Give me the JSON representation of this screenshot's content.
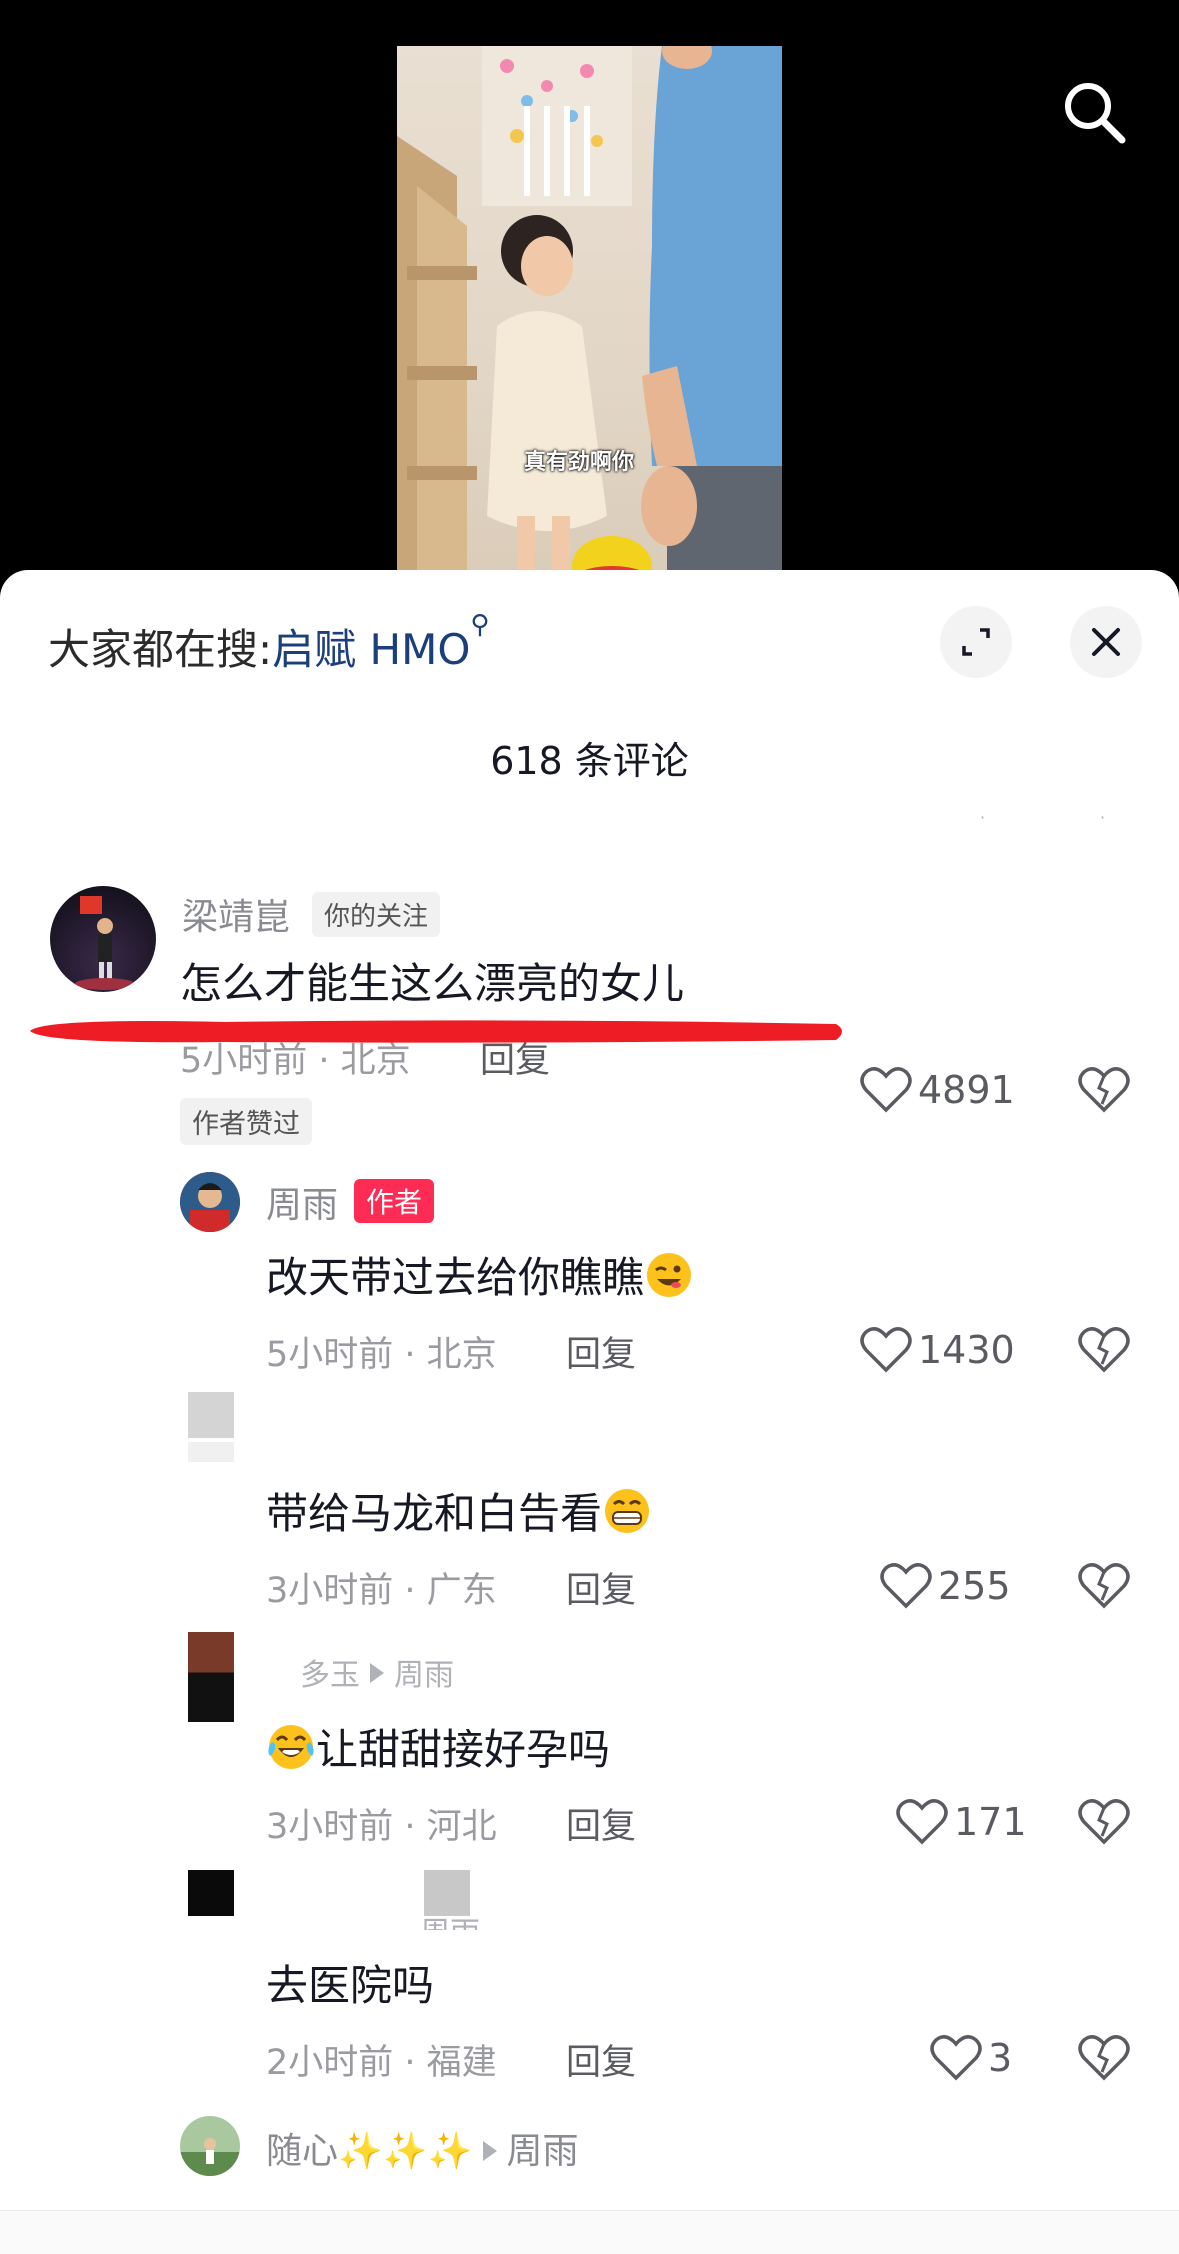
{
  "video": {
    "caption": "真有劲啊你"
  },
  "header": {
    "search_prefix": "大家都在搜:",
    "search_keyword": "启赋 HMO",
    "comment_count": "618 条评论"
  },
  "comments": [
    {
      "username": "梁靖崑",
      "tag": "你的关注",
      "text": "怎么才能生这么漂亮的女儿",
      "meta": "5小时前 · 北京",
      "reply": "回复",
      "likes": "4891",
      "liked_tag": "作者赞过"
    },
    {
      "username": "周雨",
      "tag": "作者",
      "text": "改天带过去给你瞧瞧",
      "emoji": "winking-face",
      "meta": "5小时前 · 北京",
      "reply": "回复",
      "likes": "1430"
    },
    {
      "username": "",
      "text": "带给马龙和白告看",
      "emoji": "grinning-face",
      "meta": "3小时前 · 广东",
      "reply": "回复",
      "likes": "255"
    },
    {
      "username": "多玉",
      "reply_to": "周雨",
      "text": "让甜甜接好孕吗",
      "emoji": "laughing-crying-face",
      "meta": "3小时前 · 河北",
      "reply": "回复",
      "likes": "171"
    },
    {
      "username": "",
      "reply_to": "周雨",
      "text": "去医院吗",
      "meta": "2小时前 · 福建",
      "reply": "回复",
      "likes": "3"
    },
    {
      "username": "随心",
      "reply_to": "周雨"
    }
  ],
  "colors": {
    "accent_red": "#fe2c55",
    "keyword_blue": "#1a3f7a",
    "stroke_red": "#ee1c25"
  }
}
